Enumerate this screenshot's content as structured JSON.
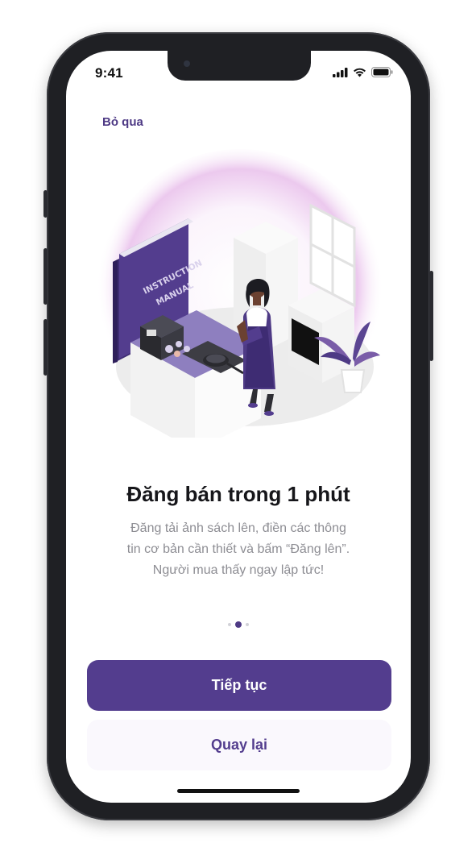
{
  "status_bar": {
    "time": "9:41"
  },
  "onboarding": {
    "skip_label": "Bỏ qua",
    "title": "Đăng bán trong 1 phút",
    "description_lines": [
      "Đăng tải ảnh sách lên, điền các thông",
      "tin cơ bản cần thiết và bấm “Đăng lên”.",
      "Người mua thấy ngay lập tức!"
    ],
    "illustration_text": [
      "INSTRUCTION",
      "MANUAL"
    ],
    "page_indicator": {
      "total": 3,
      "current": 2
    },
    "continue_label": "Tiếp tục",
    "back_label": "Quay lại"
  },
  "colors": {
    "primary": "#533d8e",
    "secondary_bg": "#faf8fd",
    "text_dark": "#16161a",
    "text_muted": "#8d8d93"
  }
}
